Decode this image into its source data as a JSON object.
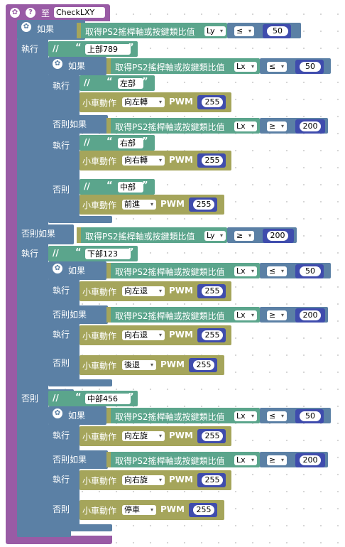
{
  "colors": {
    "procedure": "#995ba5",
    "logic": "#5b80a5",
    "text": "#5ba58c",
    "math": "#3f4cad",
    "car": "#a5a55b"
  },
  "procedure": {
    "keyword": "至",
    "name": "CheckLXY"
  },
  "kw": {
    "if": "如果",
    "do": "執行",
    "elseif": "否則如果",
    "else": "否則",
    "car": "小車動作",
    "pwm": "PWM",
    "ps2": "取得PS2搖桿軸或按鍵類比值",
    "comment": "//",
    "qopen": "“",
    "qclose": "”",
    "dd_arrow": "▾"
  },
  "icons": {
    "gear": "gear-icon",
    "help": "help-icon",
    "comment": "comment-icon"
  },
  "conditions": {
    "outer_if": {
      "axis": "Ly",
      "op": "≤",
      "value": "50"
    },
    "up_if": {
      "axis": "Lx",
      "op": "≤",
      "value": "50"
    },
    "up_elseif": {
      "axis": "Lx",
      "op": "≥",
      "value": "200"
    },
    "outer_elseif": {
      "axis": "Ly",
      "op": "≥",
      "value": "200"
    },
    "down_if": {
      "axis": "Lx",
      "op": "≤",
      "value": "50"
    },
    "down_elseif": {
      "axis": "Lx",
      "op": "≥",
      "value": "200"
    },
    "mid_if": {
      "axis": "Lx",
      "op": "≤",
      "value": "50"
    },
    "mid_elseif": {
      "axis": "Lx",
      "op": "≥",
      "value": "200"
    }
  },
  "comments": {
    "up": "上部789",
    "left": "左部",
    "right": "右部",
    "center": "中部",
    "down": "下部123",
    "mid": "中部456"
  },
  "actions": {
    "up_left": {
      "dir": "向左轉",
      "pwm": "255"
    },
    "up_right": {
      "dir": "向右轉",
      "pwm": "255"
    },
    "up_else": {
      "dir": "前進",
      "pwm": "255"
    },
    "down_left": {
      "dir": "向左退",
      "pwm": "255"
    },
    "down_right": {
      "dir": "向右退",
      "pwm": "255"
    },
    "down_else": {
      "dir": "後退",
      "pwm": "255"
    },
    "mid_left": {
      "dir": "向左旋",
      "pwm": "255"
    },
    "mid_right": {
      "dir": "向右旋",
      "pwm": "255"
    },
    "mid_else": {
      "dir": "停車",
      "pwm": "255"
    }
  }
}
